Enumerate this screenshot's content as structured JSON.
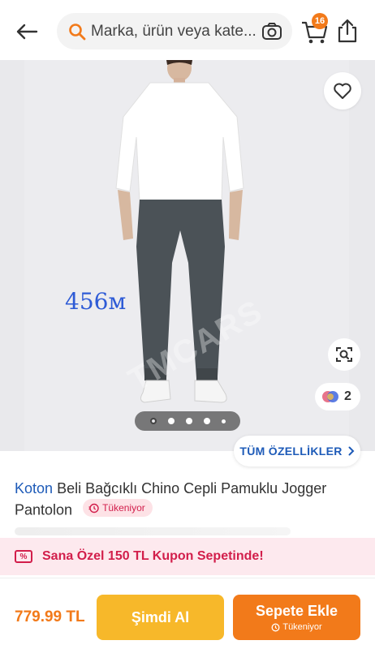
{
  "header": {
    "search_placeholder": "Marka, ürün veya kate...",
    "cart_count": "16"
  },
  "gallery": {
    "annotation": "456м",
    "watermark": "TMCARS",
    "color_count": "2",
    "pager_total": 5,
    "pager_active": 1
  },
  "features": {
    "label": "TÜM ÖZELLİKLER"
  },
  "product": {
    "brand": "Koton",
    "name": "Beli Bağcıklı Chino Cepli Pamuklu Jogger Pantolon",
    "stock_badge": "Tükeniyor"
  },
  "coupon": {
    "icon_text": "%",
    "text": "Sana Özel 150 TL Kupon Sepetinde!"
  },
  "bottom": {
    "price": "779.99 TL",
    "buy_now": "Şimdi Al",
    "add_to_cart": "Sepete Ekle",
    "add_to_cart_sub": "Tükeniyor"
  },
  "colors": {
    "accent_orange": "#f27a1a",
    "buy_yellow": "#f7b82a",
    "link_blue": "#1e5bb8",
    "alert_pink": "#d21e4b"
  },
  "icons": [
    "back-arrow-icon",
    "search-icon",
    "camera-icon",
    "cart-icon",
    "share-icon",
    "heart-icon",
    "lens-search-icon",
    "color-variants-icon",
    "chevron-right-icon",
    "clock-icon",
    "coupon-tag-icon"
  ]
}
